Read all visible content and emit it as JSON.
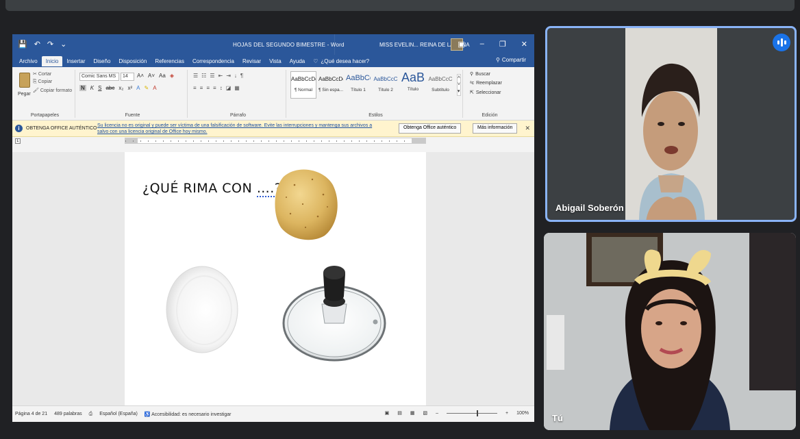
{
  "word": {
    "quick_access": [
      "💾",
      "↶",
      "↷",
      "⌄"
    ],
    "title": "HOJAS DEL SEGUNDO BIMESTRE  -  Word",
    "user": "MISS EVELIN... REINA DE LA LUNA",
    "window_buttons": [
      "▣",
      "–",
      "❐",
      "✕"
    ],
    "tabs": [
      "Archivo",
      "Inicio",
      "Insertar",
      "Diseño",
      "Disposición",
      "Referencias",
      "Correspondencia",
      "Revisar",
      "Vista",
      "Ayuda"
    ],
    "tell_me": "¿Qué desea hacer?",
    "share": "Compartir",
    "ribbon": {
      "clipboard": {
        "paste": "Pegar",
        "cut": "Cortar",
        "copy": "Copiar",
        "format_painter": "Copiar formato",
        "label": "Portapapeles"
      },
      "font": {
        "name": "Comic Sans MS",
        "size": "14",
        "label": "Fuente"
      },
      "paragraph": {
        "label": "Párrafo"
      },
      "styles": {
        "label": "Estilos",
        "items": [
          {
            "preview": "AaBbCcDc",
            "name": "¶ Normal"
          },
          {
            "preview": "AaBbCcDc",
            "name": "¶ Sin espa..."
          },
          {
            "preview": "AaBbCc",
            "name": "Título 1"
          },
          {
            "preview": "AaBbCcC",
            "name": "Título 2"
          },
          {
            "preview": "AaB",
            "name": "Título"
          },
          {
            "preview": "AaBbCcC",
            "name": "Subtítulo"
          }
        ]
      },
      "editing": {
        "find": "Buscar",
        "replace": "Reemplazar",
        "select": "Seleccionar",
        "label": "Edición"
      }
    },
    "infobar": {
      "title": "OBTENGA OFFICE AUTÉNTICO",
      "message": "Su licencia no es original y puede ser víctima de una falsificación de software. Evite las interrupciones y mantenga sus archivos a salvo con una licencia original de Office hoy mismo.",
      "btn_get": "Obtenga Office auténtico",
      "btn_more": "Más información"
    },
    "document": {
      "heading": "¿QUÉ RIMA CON ",
      "heading_dots": "….",
      "heading_end": "?"
    },
    "status": {
      "page": "Página 4 de 21",
      "words": "489 palabras",
      "language": "Español (España)",
      "accessibility": "Accesibilidad: es necesario investigar",
      "zoom": "100%"
    }
  },
  "participants": [
    {
      "name": "Abigail Soberón"
    },
    {
      "name": "Tú"
    }
  ],
  "colors": {
    "word_blue": "#2b579a",
    "active_speaker_border": "#8ab4f8",
    "meet_bg": "#202124"
  }
}
